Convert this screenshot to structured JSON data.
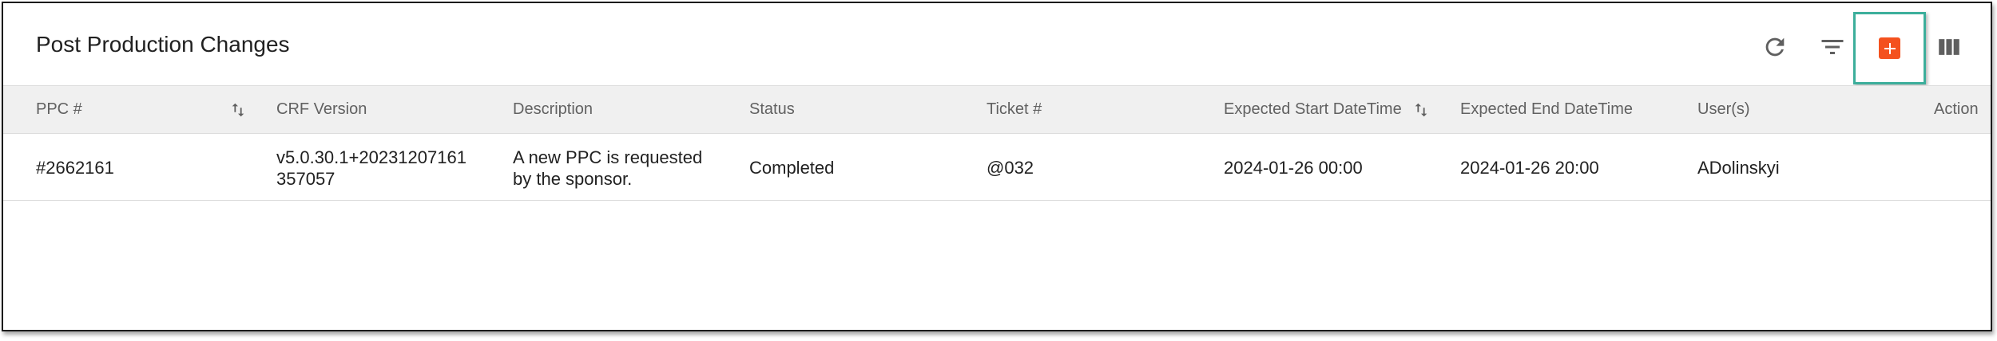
{
  "page": {
    "title": "Post Production Changes"
  },
  "toolbar": {
    "refresh_icon": "refresh-icon",
    "filter_icon": "filter-icon",
    "add_icon": "plus-icon",
    "columns_icon": "columns-icon",
    "add_color": "#f4511e",
    "highlight_color": "#3cae9b"
  },
  "table": {
    "columns": [
      "PPC #",
      "CRF Version",
      "Description",
      "Status",
      "Ticket #",
      "Expected Start DateTime",
      "Expected End DateTime",
      "User(s)",
      "Action"
    ],
    "rows": [
      {
        "ppc": "#2662161",
        "crf_version_line1": "v5.0.30.1+20231207161",
        "crf_version_line2": "357057",
        "description_line1": "A new PPC is requested",
        "description_line2": "by the sponsor.",
        "status": "Completed",
        "ticket": "@032",
        "start": "2024-01-26 00:00",
        "end": "2024-01-26 20:00",
        "users": "ADolinskyi",
        "action": ""
      }
    ]
  }
}
